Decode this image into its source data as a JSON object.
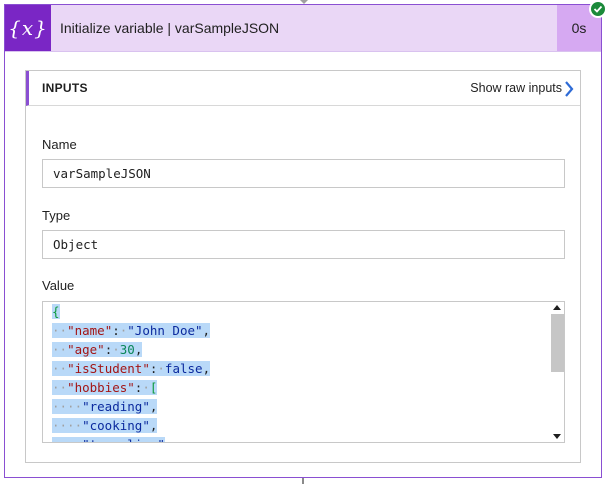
{
  "header": {
    "icon_glyph": "{x}",
    "icon_name": "variable-icon",
    "title": "Initialize variable | varSampleJSON",
    "duration": "0s",
    "status": "succeeded",
    "accent_color": "#7a26c5",
    "header_bg": "#ead7f6"
  },
  "inputs": {
    "section_label": "INPUTS",
    "raw_link": "Show raw inputs"
  },
  "fields": {
    "name_label": "Name",
    "name_value": "varSampleJSON",
    "type_label": "Type",
    "type_value": "Object",
    "value_label": "Value"
  },
  "value_code_lines": [
    "{",
    "  \"name\": \"John Doe\",",
    "  \"age\": 30,",
    "  \"isStudent\": false,",
    "  \"hobbies\": [",
    "    \"reading\",",
    "    \"cooking\",",
    "    \"traveling\""
  ]
}
